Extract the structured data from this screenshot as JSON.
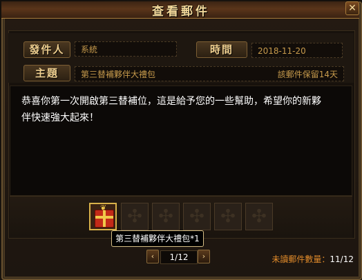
{
  "window": {
    "title": "查看郵件",
    "close_icon": "close-icon"
  },
  "mail": {
    "sender_label": "發件人",
    "sender": "系統",
    "time_label": "時間",
    "time": "2018-11-20",
    "subject_label": "主題",
    "subject": "第三替補夥伴大禮包",
    "retention": "該郵件保留14天",
    "body_line1": "恭喜你第一次開啟第三替補位，這是給予您的一些幫助，希望你的新夥",
    "body_line2": "伴快速強大起來！"
  },
  "attachments": {
    "items": [
      {
        "icon": "gift-box-icon",
        "tooltip": "第三替補夥伴大禮包*1"
      },
      {
        "icon": "empty-slot-icon"
      },
      {
        "icon": "empty-slot-icon"
      },
      {
        "icon": "empty-slot-icon"
      },
      {
        "icon": "empty-slot-icon"
      },
      {
        "icon": "empty-slot-icon"
      }
    ]
  },
  "pager": {
    "prev": "‹",
    "next": "›",
    "text": "1/12"
  },
  "footer": {
    "unread_label": "未讀郵件數量：",
    "unread_value": "11/12"
  },
  "colors": {
    "frame": "#6b5330",
    "accent": "#f3d99a",
    "body_bg": "#0c0907"
  }
}
